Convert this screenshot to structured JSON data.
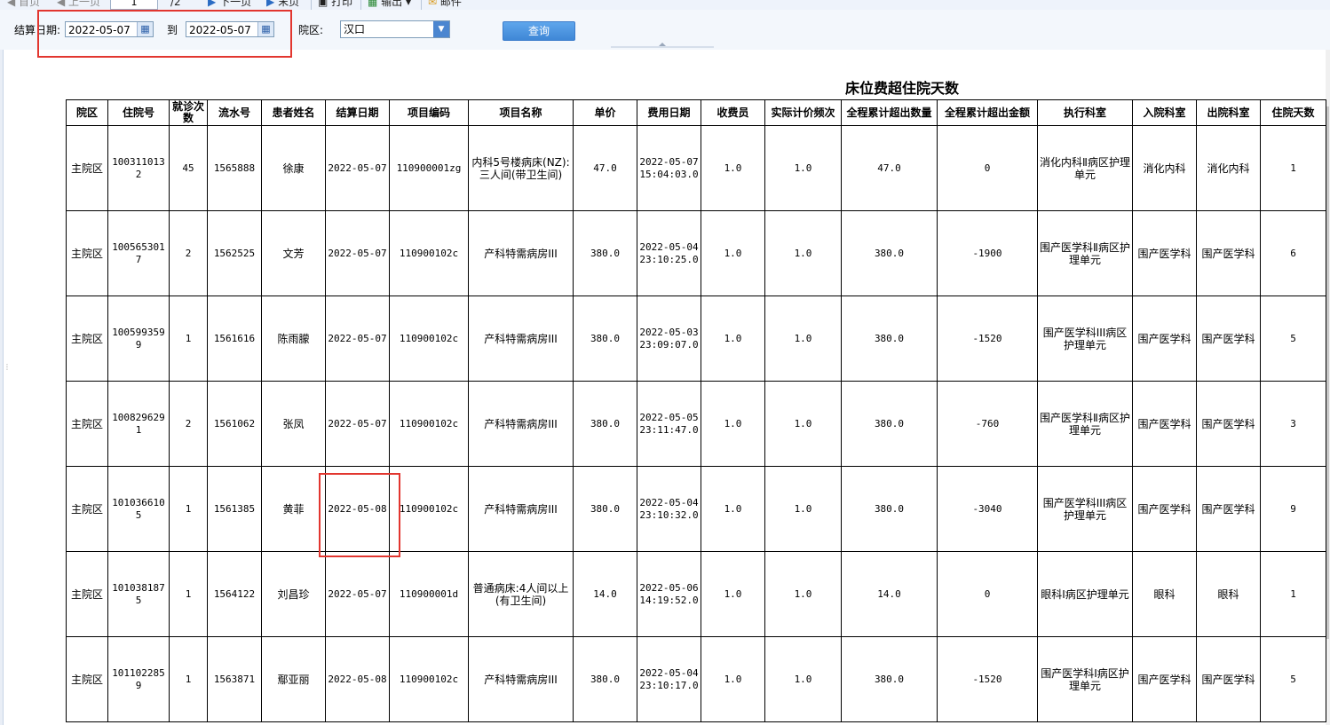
{
  "toolbar": {
    "first": "首页",
    "prev": "上一页",
    "page_current": "1",
    "page_total": "/2",
    "next": "下一页",
    "last": "末页",
    "print": "打印",
    "export": "输出",
    "mail": "邮件"
  },
  "filter": {
    "date_label": "结算日期:",
    "date_from": "2022-05-07",
    "to_label": "到",
    "date_to": "2022-05-07",
    "area_label": "院区:",
    "area_value": "汉口",
    "query_button": "查询"
  },
  "report": {
    "title": "床位费超住院天数",
    "columns": [
      "院区",
      "住院号",
      "就诊次数",
      "流水号",
      "患者姓名",
      "结算日期",
      "项目编码",
      "项目名称",
      "单价",
      "费用日期",
      "收费员",
      "实际计价频次",
      "全程累计超出数量",
      "全程累计超出金额",
      "执行科室",
      "入院科室",
      "出院科室",
      "住院天数"
    ],
    "rows": [
      [
        "主院区",
        "1003110132",
        "45",
        "1565888",
        "徐康",
        "2022-05-07",
        "110900001zg",
        "内科5号楼病床(NZ):三人间(带卫生间)",
        "47.0",
        "2022-05-07 15:04:03.0",
        "1.0",
        "1.0",
        "47.0",
        "0",
        "消化内科Ⅱ病区护理单元",
        "消化内科",
        "消化内科",
        "1"
      ],
      [
        "主院区",
        "1005653017",
        "2",
        "1562525",
        "文芳",
        "2022-05-07",
        "110900102c",
        "产科特需病房III",
        "380.0",
        "2022-05-04 23:10:25.0",
        "1.0",
        "1.0",
        "380.0",
        "-1900",
        "围产医学科Ⅱ病区护理单元",
        "围产医学科",
        "围产医学科",
        "6"
      ],
      [
        "主院区",
        "1005993599",
        "1",
        "1561616",
        "陈雨朦",
        "2022-05-07",
        "110900102c",
        "产科特需病房III",
        "380.0",
        "2022-05-03 23:09:07.0",
        "1.0",
        "1.0",
        "380.0",
        "-1520",
        "围产医学科III病区护理单元",
        "围产医学科",
        "围产医学科",
        "5"
      ],
      [
        "主院区",
        "1008296291",
        "2",
        "1561062",
        "张凤",
        "2022-05-07",
        "110900102c",
        "产科特需病房III",
        "380.0",
        "2022-05-05 23:11:47.0",
        "1.0",
        "1.0",
        "380.0",
        "-760",
        "围产医学科Ⅱ病区护理单元",
        "围产医学科",
        "围产医学科",
        "3"
      ],
      [
        "主院区",
        "1010366105",
        "1",
        "1561385",
        "黄菲",
        "2022-05-08",
        "110900102c",
        "产科特需病房III",
        "380.0",
        "2022-05-04 23:10:32.0",
        "1.0",
        "1.0",
        "380.0",
        "-3040",
        "围产医学科III病区护理单元",
        "围产医学科",
        "围产医学科",
        "9"
      ],
      [
        "主院区",
        "1010381875",
        "1",
        "1564122",
        "刘昌珍",
        "2022-05-07",
        "110900001d",
        "普通病床:4人间以上(有卫生间)",
        "14.0",
        "2022-05-06 14:19:52.0",
        "1.0",
        "1.0",
        "14.0",
        "0",
        "眼科Ⅰ病区护理单元",
        "眼科",
        "眼科",
        "1"
      ],
      [
        "主院区",
        "1011022859",
        "1",
        "1563871",
        "鄢亚丽",
        "2022-05-08",
        "110900102c",
        "产科特需病房III",
        "380.0",
        "2022-05-04 23:10:17.0",
        "1.0",
        "1.0",
        "380.0",
        "-1520",
        "围产医学科Ⅰ病区护理单元",
        "围产医学科",
        "围产医学科",
        "5"
      ]
    ]
  },
  "colors": {
    "highlight_box": "#e2362f",
    "query_button": "#4a8fdc",
    "toolbar_bg": "#eef3fb"
  }
}
